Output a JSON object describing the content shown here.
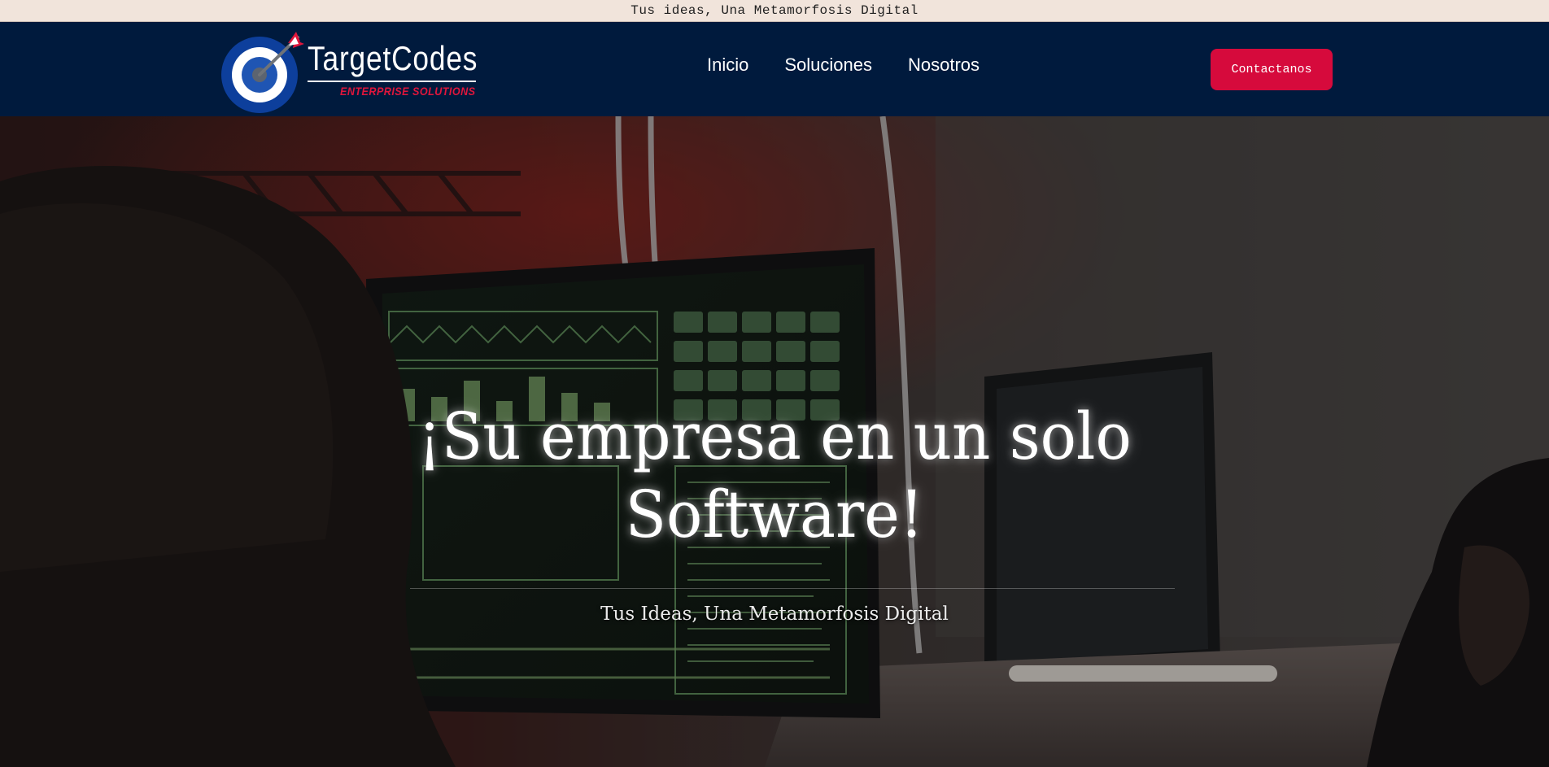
{
  "announcement": {
    "text": "Tus ideas, Una Metamorfosis Digital"
  },
  "brand": {
    "name": "TargetCodes",
    "tagline": "ENTERPRISE SOLUTIONS",
    "icon": "target-dart-icon",
    "colors": {
      "navy": "#001a3d",
      "accent_red": "#d60a3c",
      "target_blue": "#0d3f9c"
    }
  },
  "nav": {
    "items": [
      {
        "label": "Inicio"
      },
      {
        "label": "Soluciones"
      },
      {
        "label": "Nosotros"
      }
    ],
    "cta_label": "Contactanos"
  },
  "hero": {
    "title": "¡Su empresa en un solo Software!",
    "subtitle": "Tus Ideas, Una Metamorfosis Digital",
    "background": "dark photo of hooded people at computer monitors with green terminal readouts"
  }
}
